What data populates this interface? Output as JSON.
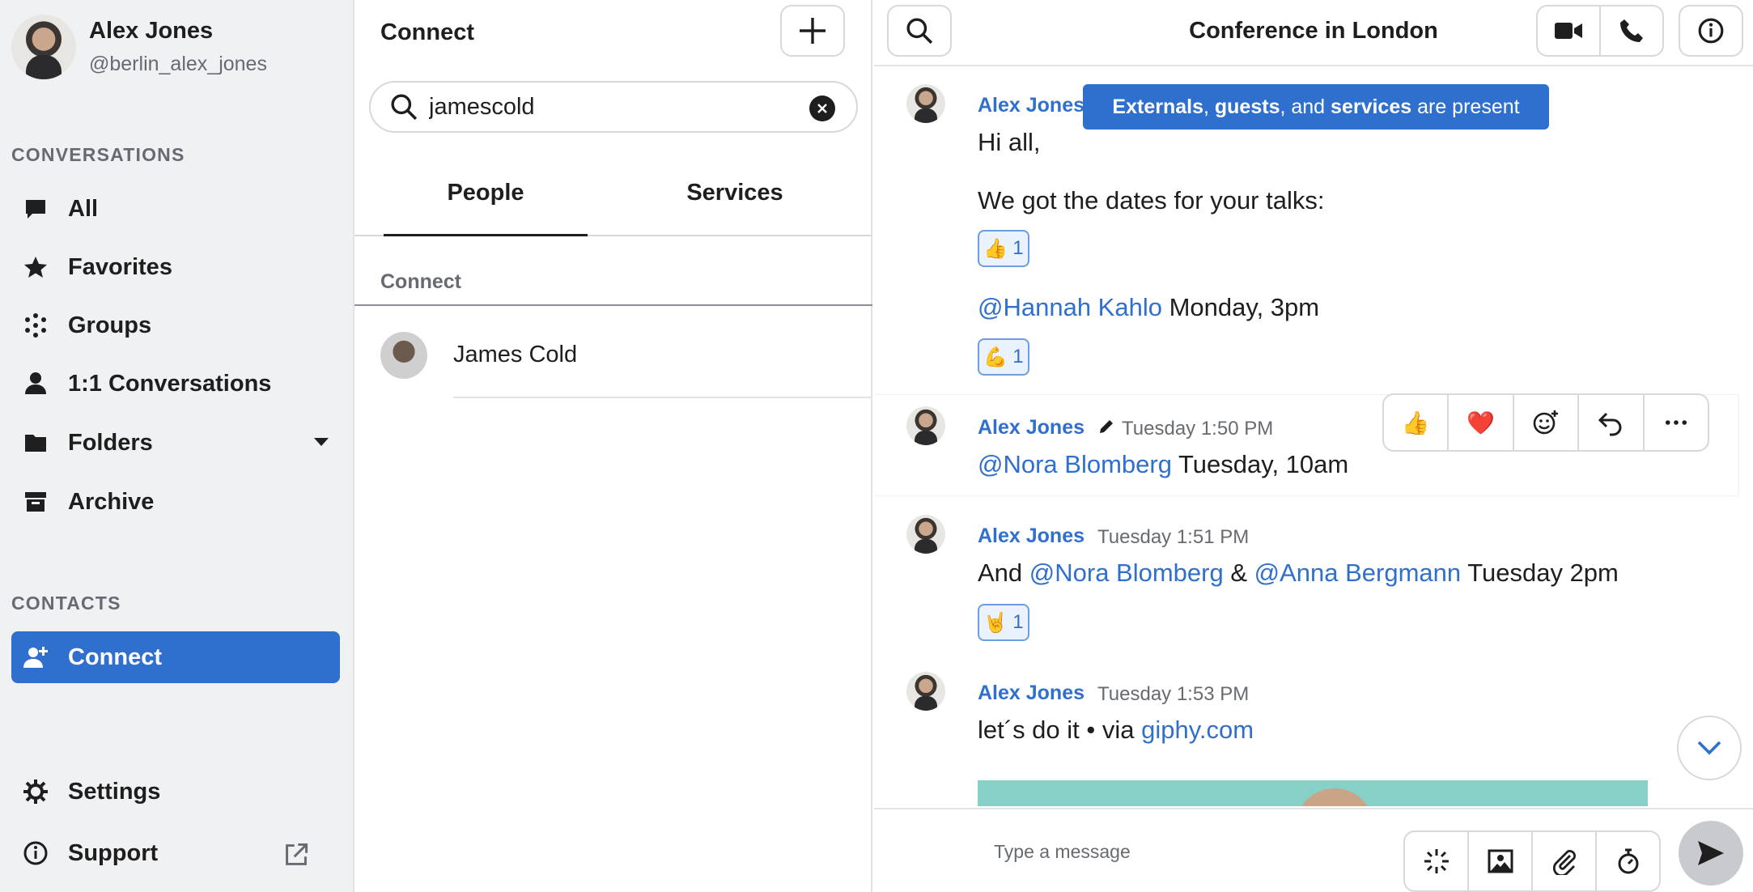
{
  "profile": {
    "name": "Alex Jones",
    "handle": "@berlin_alex_jones"
  },
  "sidebar": {
    "conversations_label": "CONVERSATIONS",
    "items": [
      {
        "label": "All",
        "icon": "chat-bubble-icon"
      },
      {
        "label": "Favorites",
        "icon": "star-icon"
      },
      {
        "label": "Groups",
        "icon": "groups-dots-icon"
      },
      {
        "label": "1:1 Conversations",
        "icon": "person-icon"
      },
      {
        "label": "Folders",
        "icon": "folder-icon"
      },
      {
        "label": "Archive",
        "icon": "archive-box-icon"
      }
    ],
    "contacts_label": "CONTACTS",
    "connect_label": "Connect",
    "settings_label": "Settings",
    "support_label": "Support"
  },
  "middle": {
    "title": "Connect",
    "search_value": "jamescold",
    "tabs": [
      "People",
      "Services"
    ],
    "list_header": "Connect",
    "results": [
      {
        "name": "James Cold"
      }
    ]
  },
  "conversation": {
    "title": "Conference in London",
    "tooltip": {
      "part1": "Externals",
      "sep1": ", ",
      "part2": "guests",
      "sep2": ", and ",
      "part3": "services",
      "tail": " are present"
    },
    "messages": [
      {
        "sender": "Alex Jones",
        "line1": "Hi all,",
        "line2": "We got the dates for your talks:",
        "reaction1": {
          "emoji": "👍",
          "count": "1"
        },
        "line3_mention": "@Hannah Kahlo",
        "line3_text": " Monday, 3pm",
        "reaction2": {
          "emoji": "💪",
          "count": "1"
        }
      },
      {
        "sender": "Alex Jones",
        "time": "Tuesday 1:50 PM",
        "mention": "@Nora Blomberg",
        "text": " Tuesday, 10am"
      },
      {
        "sender": "Alex Jones",
        "time": "Tuesday 1:51 PM",
        "prefix": "And ",
        "mention1": "@Nora Blomberg",
        "middle": " & ",
        "mention2": "@Anna Bergmann",
        "suffix": " Tuesday 2pm",
        "reaction": {
          "emoji": "🤘",
          "count": "1"
        }
      },
      {
        "sender": "Alex Jones",
        "time": "Tuesday 1:53 PM",
        "text": "let´s do it • via ",
        "link": "giphy.com"
      }
    ],
    "toolbar": {
      "like": "👍",
      "heart": "❤️"
    },
    "composer_placeholder": "Type a message"
  },
  "colors": {
    "accent": "#2f6fce",
    "sidebar_bg": "#f0f1f3"
  }
}
